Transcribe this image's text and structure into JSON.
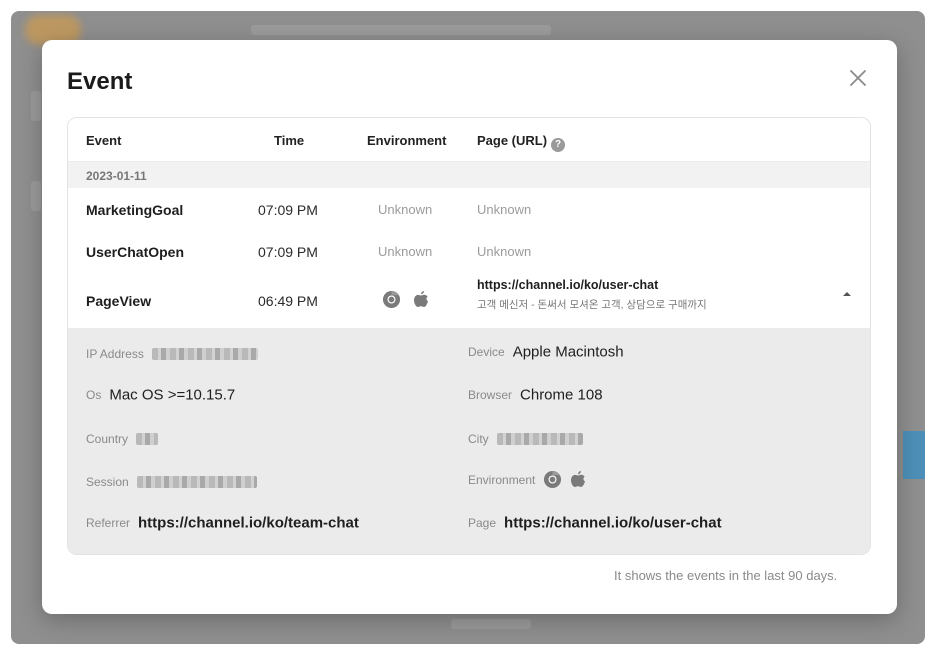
{
  "modal": {
    "title": "Event",
    "footer_note": "It shows the events in the last 90 days."
  },
  "table": {
    "headers": {
      "event": "Event",
      "time": "Time",
      "environment": "Environment",
      "page": "Page (URL)"
    },
    "date_group": "2023-01-11",
    "rows": [
      {
        "event": "MarketingGoal",
        "time": "07:09 PM",
        "environment": "Unknown",
        "page": "Unknown"
      },
      {
        "event": "UserChatOpen",
        "time": "07:09 PM",
        "environment": "Unknown",
        "page": "Unknown"
      },
      {
        "event": "PageView",
        "time": "06:49 PM",
        "environment_icons": [
          "chrome-icon",
          "apple-icon"
        ],
        "page_url": "https://channel.io/ko/user-chat",
        "page_title": "고객 메신저 - 돈써서 모셔온 고객, 상담으로 구매까지"
      }
    ]
  },
  "details": {
    "ip_address": {
      "label": "IP Address",
      "value": ""
    },
    "device": {
      "label": "Device",
      "value": "Apple Macintosh"
    },
    "os": {
      "label": "Os",
      "value": "Mac OS >=10.15.7"
    },
    "browser": {
      "label": "Browser",
      "value": "Chrome 108"
    },
    "country": {
      "label": "Country",
      "value": ""
    },
    "city": {
      "label": "City",
      "value": ""
    },
    "session": {
      "label": "Session",
      "value": ""
    },
    "environment": {
      "label": "Environment",
      "icons": [
        "chrome-icon",
        "apple-icon"
      ]
    },
    "referrer": {
      "label": "Referrer",
      "value": "https://channel.io/ko/team-chat"
    },
    "page": {
      "label": "Page",
      "value": "https://channel.io/ko/user-chat"
    }
  },
  "colors": {
    "backdrop": "#8f8f8f",
    "detail_panel": "#ebebeb",
    "muted_text": "#9b9b9b"
  }
}
